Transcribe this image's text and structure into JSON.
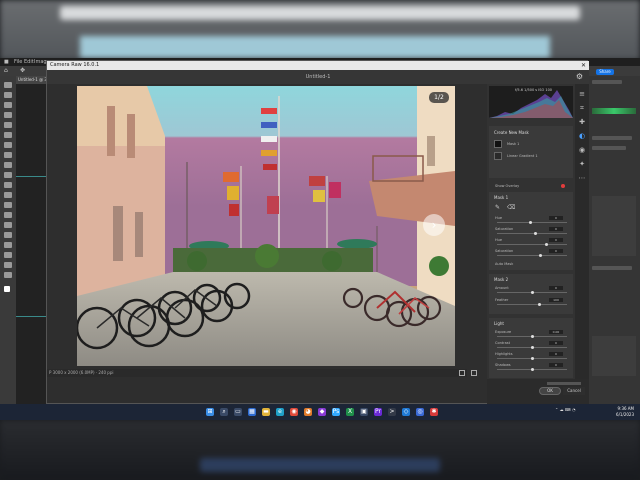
{
  "photoshop": {
    "menu": [
      "File",
      "Edit",
      "Image"
    ],
    "doc_tab": "Untitled-1 @ 33.3%",
    "share_label": "Share"
  },
  "dialog": {
    "title": "Camera Raw 16.0.1",
    "filename": "Untitled-1",
    "image_counter": "1/2",
    "status_text": "P 3000 x 2000 (6.0MP) · 240 ppi",
    "ok_label": "OK",
    "cancel_label": "Cancel"
  },
  "panel": {
    "histogram_readout": "f/5.6  1/500 s  ISO 100",
    "profile_section": "Create New Mask",
    "mask_items": [
      "Mask 1",
      "Linear Gradient 1"
    ],
    "overlay_label": "Show Overlay",
    "mask1_label": "Mask 1",
    "sliders_top": [
      {
        "label": "Hue",
        "value": "0",
        "pos": 0.48
      },
      {
        "label": "Saturation",
        "value": "0",
        "pos": 0.55
      },
      {
        "label": "Hue",
        "value": "0",
        "pos": 0.7
      },
      {
        "label": "Saturation",
        "value": "0",
        "pos": 0.62
      }
    ],
    "grain_checkbox": "Auto Mask",
    "mask2_label": "Mask 2",
    "sliders_mid": [
      {
        "label": "Amount",
        "value": "0",
        "pos": 0.5
      },
      {
        "label": "Feather",
        "value": "100",
        "pos": 0.6
      }
    ],
    "light_section": "Light",
    "sliders_light": [
      {
        "label": "Exposure",
        "value": "0.00",
        "pos": 0.5
      },
      {
        "label": "Contrast",
        "value": "0",
        "pos": 0.5
      },
      {
        "label": "Highlights",
        "value": "0",
        "pos": 0.5
      },
      {
        "label": "Shadows",
        "value": "0",
        "pos": 0.5
      }
    ]
  },
  "taskbar": {
    "icons": [
      {
        "name": "windows-start-icon",
        "color": "#3a8ee6",
        "glyph": "⊞"
      },
      {
        "name": "search-icon",
        "color": "#3a4a66",
        "glyph": "⌕"
      },
      {
        "name": "task-view-icon",
        "color": "#3a4a66",
        "glyph": "▭"
      },
      {
        "name": "widgets-icon",
        "color": "#2d6bd1",
        "glyph": "▦"
      },
      {
        "name": "file-explorer-icon",
        "color": "#e0b33a",
        "glyph": "▬"
      },
      {
        "name": "edge-icon",
        "color": "#1fa0c9",
        "glyph": "e"
      },
      {
        "name": "chrome-icon",
        "color": "#e04a3a",
        "glyph": "◉"
      },
      {
        "name": "firefox-icon",
        "color": "#e07a2a",
        "glyph": "◕"
      },
      {
        "name": "app-icon",
        "color": "#8a3ad6",
        "glyph": "◆"
      },
      {
        "name": "photoshop-icon",
        "color": "#31a8ff",
        "glyph": "Ps"
      },
      {
        "name": "excel-icon",
        "color": "#1f8f4a",
        "glyph": "X"
      },
      {
        "name": "app2-icon",
        "color": "#3a4a66",
        "glyph": "▣"
      },
      {
        "name": "premiere-icon",
        "color": "#6a2ad6",
        "glyph": "Pr"
      },
      {
        "name": "terminal-icon",
        "color": "#333a48",
        "glyph": ">"
      },
      {
        "name": "vscode-icon",
        "color": "#1f7ad6",
        "glyph": "◇"
      },
      {
        "name": "app3-icon",
        "color": "#3a6ad6",
        "glyph": "◎"
      },
      {
        "name": "app4-icon",
        "color": "#d63a3a",
        "glyph": "✱"
      }
    ],
    "time": "9:36 AM",
    "date": "6/1/2023"
  },
  "colors": {
    "accent": "#1473e6",
    "dialog_bg": "#2e2e2e",
    "taskbar_bg": "#1c2536"
  }
}
